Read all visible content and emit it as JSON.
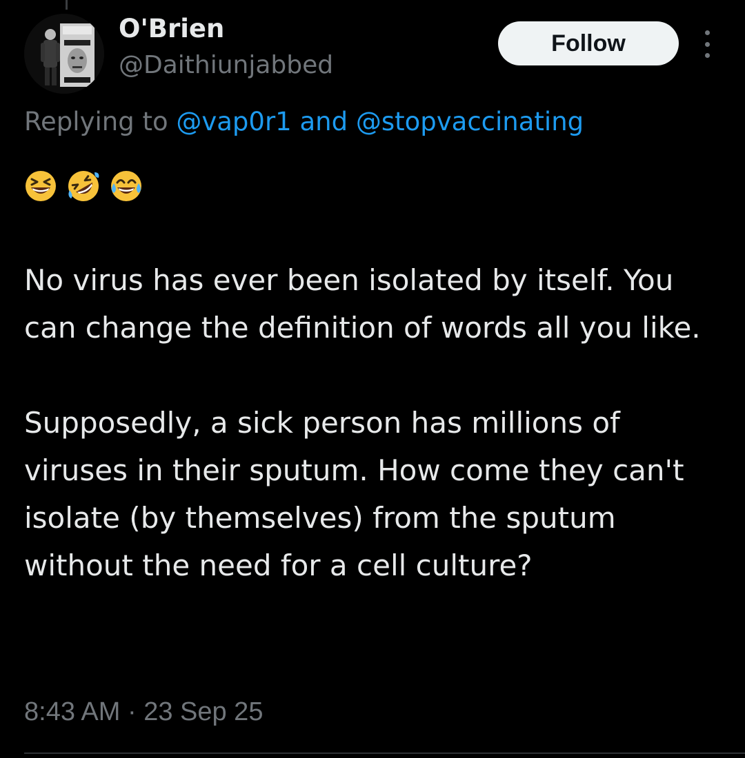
{
  "author": {
    "display_name": "O'Brien",
    "handle": "@Daithiunjabbed",
    "avatar_icon": "avatar-image"
  },
  "follow_label": "Follow",
  "more_icon": "more-options-icon",
  "reply": {
    "prefix": "Replying to ",
    "mention_1": "@vap0r1",
    "connector": " and ",
    "mention_2": "@stopvaccinating"
  },
  "emojis": [
    "grinning-squinting-face",
    "rolling-on-floor-laughing",
    "face-with-tears-of-joy"
  ],
  "body": {
    "paragraph_1": "No virus has ever been isolated by itself. You can change the definition of words all you like.",
    "paragraph_2": "Supposedly, a sick person has millions of viruses in their sputum. How come they can't isolate (by themselves) from the sputum without the need for a cell culture?"
  },
  "timestamp": "8:43 AM · 23 Sep 25",
  "colors": {
    "background": "#000000",
    "text": "#e7e9ea",
    "secondary": "#71767b",
    "link": "#1d9bf0",
    "button_bg": "#eff3f4"
  }
}
